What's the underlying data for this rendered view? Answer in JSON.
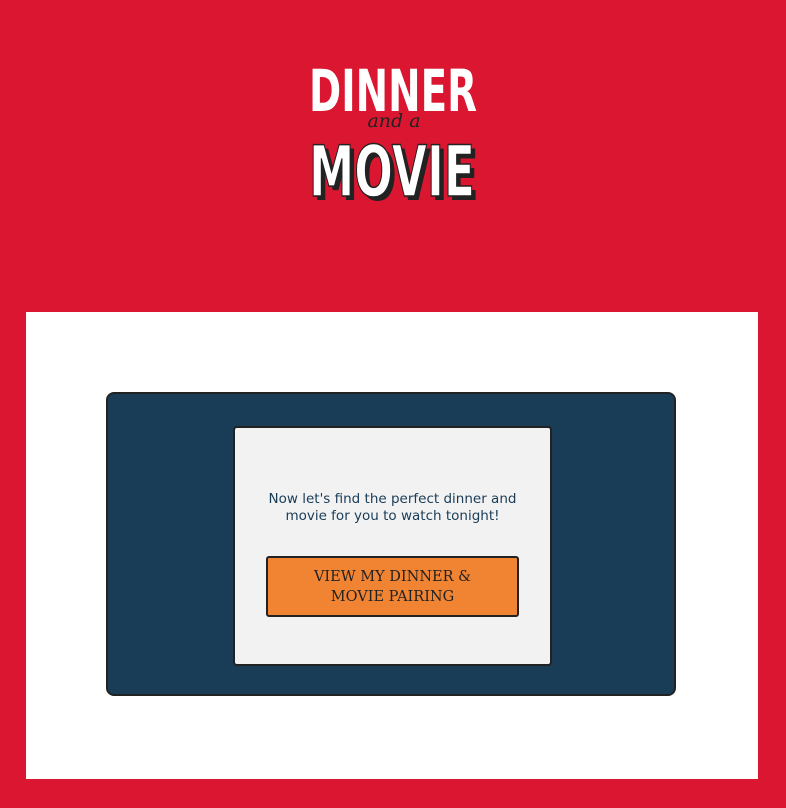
{
  "brand": {
    "logo_line1": "DINNER",
    "logo_connector": "and a",
    "logo_line2": "MOVIE"
  },
  "main": {
    "message": "Now let's find the perfect dinner and movie for you to watch tonight!",
    "cta_label": "VIEW MY DINNER & MOVIE PAIRING"
  },
  "colors": {
    "background": "#da1631",
    "panel": "#ffffff",
    "card": "#193c57",
    "inner": "#f2f2f2",
    "button": "#f08433",
    "text_dark": "#193c57"
  }
}
